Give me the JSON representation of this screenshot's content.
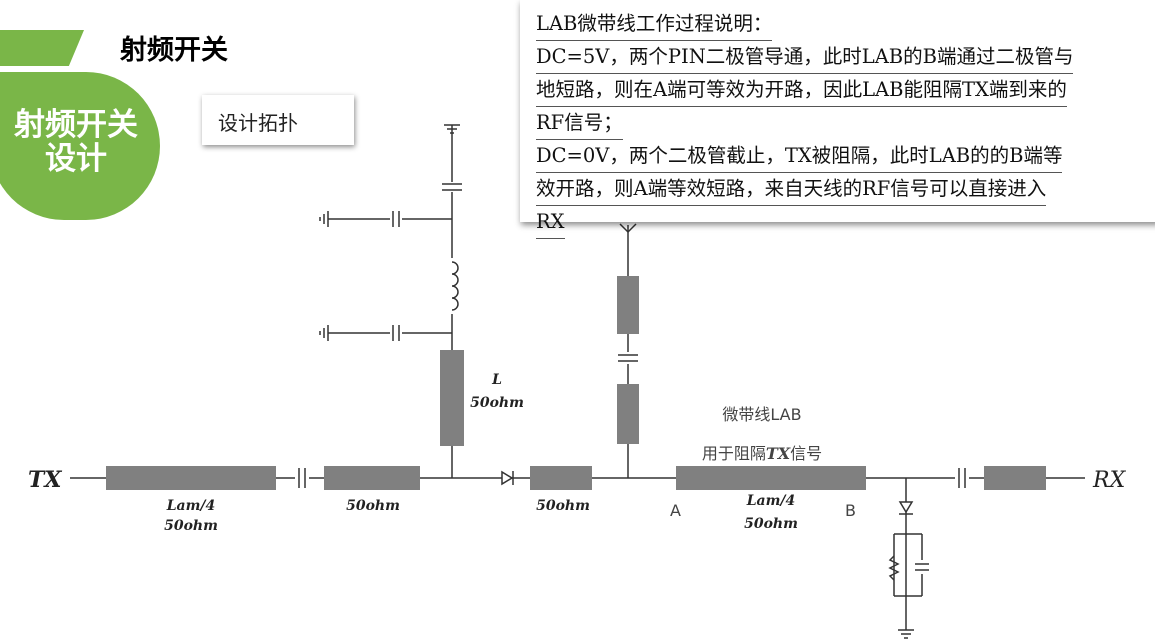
{
  "header": {
    "title": "射频开关"
  },
  "section_badge": {
    "line1": "射频开关",
    "line2": "设计"
  },
  "topology_box": {
    "label": "设计拓扑"
  },
  "description": {
    "lines": [
      "LAB微带线工作过程说明：",
      "DC=5V，两个PIN二极管导通，此时LAB的B端通过二极管与",
      "地短路，则在A端可等效为开路，因此LAB能阻隔TX端到来的",
      "RF信号；",
      "DC=0V，两个二极管截止，TX被阻隔，此时LAB的的B端等",
      "效开路，则A端等效短路，来自天线的RF信号可以直接进入",
      "RX"
    ]
  },
  "circuit": {
    "tx_label": "TX",
    "rx_label": "RX",
    "line1_label_a": "Lam/4",
    "line1_label_b": "50ohm",
    "line2_label": "50ohm",
    "inductor_line_label_a": "L",
    "inductor_line_label_b": "50ohm",
    "line3_label": "50ohm",
    "lab_caption_1": "微带线LAB",
    "lab_caption_2_pre": "用于阻隔",
    "lab_caption_2_bold": "TX",
    "lab_caption_2_post": "信号",
    "lab_label_a": "Lam/4",
    "lab_label_b": "50ohm",
    "port_a": "A",
    "port_b": "B"
  },
  "colors": {
    "accent": "#7ab648",
    "line_block": "#808080",
    "wire": "#333333"
  }
}
